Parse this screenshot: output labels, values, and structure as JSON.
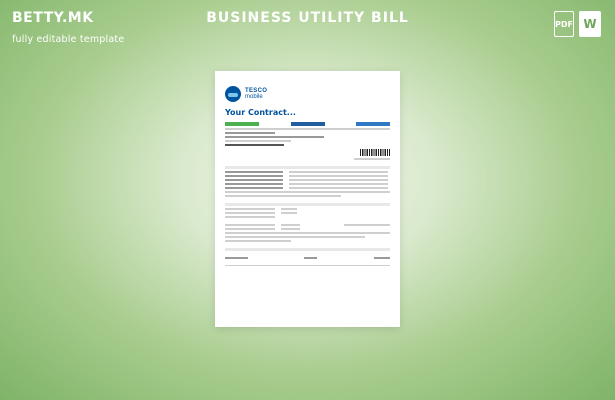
{
  "brand": {
    "logo": "BETTY.MK",
    "tagline": "fully editable template"
  },
  "header": {
    "title": "BUSINESS UTILITY BILL"
  },
  "icons": {
    "pdf_label": "PDF",
    "word_label": "W"
  },
  "document": {
    "logo_text_1": "TESCO",
    "logo_text_2": "mobile",
    "heading": "Your Contract..."
  },
  "colors": {
    "accent": "#6fa75a",
    "tesco_blue": "#00539f",
    "tab_green": "#4caf50"
  }
}
